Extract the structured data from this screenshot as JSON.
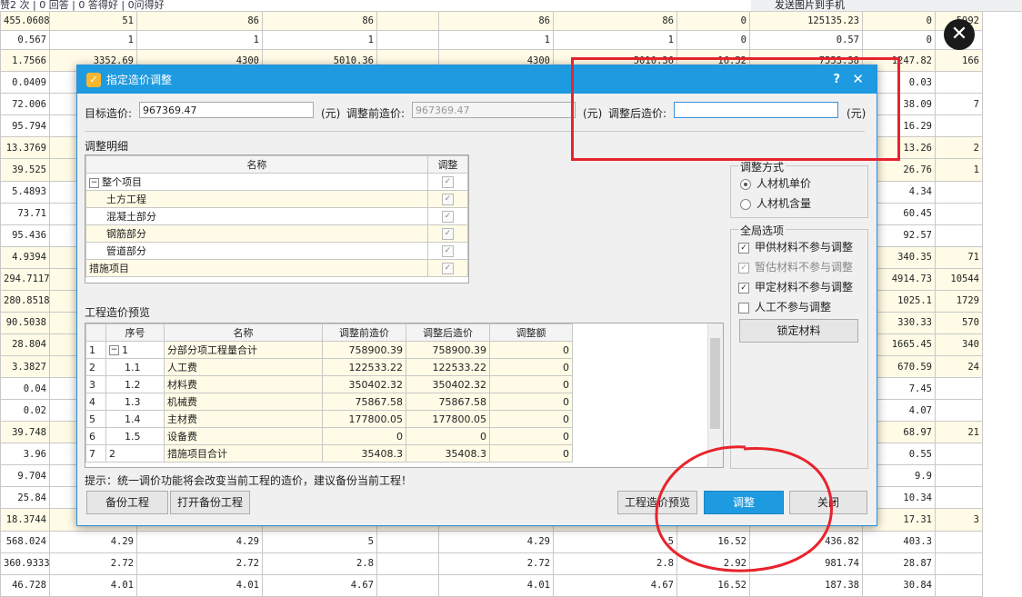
{
  "background": {
    "topbar_text": "赞2 次 | 0 回答 | 0 答得好 | 0问得好",
    "toolbar_right": [
      "发送图片到手机"
    ],
    "rows": [
      {
        "cls": "y",
        "c": [
          "455.0608",
          "51",
          "86",
          "86",
          "",
          "86",
          "86",
          "0",
          "125135.23",
          "0",
          "5992"
        ]
      },
      {
        "cls": "w",
        "c": [
          "0.567",
          "1",
          "1",
          "1",
          "",
          "1",
          "1",
          "0",
          "0.57",
          "0",
          ""
        ]
      },
      {
        "cls": "y",
        "c": [
          "1.7566",
          "3352.69",
          "4300",
          "5010.36",
          "",
          "4300",
          "5010.36",
          "16.52",
          "7553.38",
          "1247.82",
          "166"
        ]
      },
      {
        "cls": "w",
        "c": [
          "0.0409",
          "",
          "",
          "",
          "",
          "",
          "",
          "",
          "",
          "0.03",
          ""
        ]
      },
      {
        "cls": "w",
        "c": [
          "72.006",
          "",
          "",
          "",
          "",
          "",
          "",
          "",
          "",
          "38.09",
          "7"
        ]
      },
      {
        "cls": "w",
        "c": [
          "95.794",
          "",
          "",
          "",
          "",
          "",
          "",
          "",
          "",
          "16.29",
          ""
        ]
      },
      {
        "cls": "y",
        "c": [
          "13.3769",
          "",
          "",
          "",
          "",
          "",
          "",
          "",
          "",
          "13.26",
          "2"
        ]
      },
      {
        "cls": "y",
        "c": [
          "39.525",
          "",
          "",
          "",
          "",
          "",
          "",
          "",
          "",
          "26.76",
          "1"
        ]
      },
      {
        "cls": "w",
        "c": [
          "5.4893",
          "",
          "",
          "",
          "",
          "",
          "",
          "",
          "",
          "4.34",
          ""
        ]
      },
      {
        "cls": "w",
        "c": [
          "73.71",
          "",
          "",
          "",
          "",
          "",
          "",
          "",
          "",
          "60.45",
          ""
        ]
      },
      {
        "cls": "w",
        "c": [
          "95.436",
          "",
          "",
          "",
          "",
          "",
          "",
          "",
          "",
          "92.57",
          ""
        ]
      },
      {
        "cls": "y",
        "c": [
          "4.9394",
          "",
          "",
          "",
          "",
          "",
          "",
          "",
          "",
          "340.35",
          "71"
        ]
      },
      {
        "cls": "y",
        "c": [
          "294.7117",
          "",
          "",
          "",
          "",
          "",
          "",
          "",
          "",
          "4914.73",
          "10544"
        ]
      },
      {
        "cls": "y",
        "c": [
          "280.8518",
          "",
          "",
          "",
          "",
          "",
          "",
          "",
          "",
          "1025.1",
          "1729"
        ]
      },
      {
        "cls": "y",
        "c": [
          "90.5038",
          "",
          "",
          "",
          "",
          "",
          "",
          "",
          "",
          "330.33",
          "570"
        ]
      },
      {
        "cls": "y",
        "c": [
          "28.804",
          "",
          "",
          "",
          "",
          "",
          "",
          "",
          "",
          "1665.45",
          "340"
        ]
      },
      {
        "cls": "y",
        "c": [
          "3.3827",
          "",
          "",
          "",
          "",
          "",
          "",
          "",
          "",
          "670.59",
          "24"
        ]
      },
      {
        "cls": "w",
        "c": [
          "0.04",
          "",
          "",
          "",
          "",
          "",
          "",
          "",
          "",
          "7.45",
          ""
        ]
      },
      {
        "cls": "w",
        "c": [
          "0.02",
          "",
          "",
          "",
          "",
          "",
          "",
          "",
          "",
          "4.07",
          ""
        ]
      },
      {
        "cls": "y",
        "c": [
          "39.748",
          "",
          "",
          "",
          "",
          "",
          "",
          "",
          "",
          "68.97",
          "21"
        ]
      },
      {
        "cls": "w",
        "c": [
          "3.96",
          "",
          "",
          "",
          "",
          "",
          "",
          "",
          "",
          "0.55",
          ""
        ]
      },
      {
        "cls": "w",
        "c": [
          "9.704",
          "",
          "",
          "",
          "",
          "",
          "",
          "",
          "",
          "9.9",
          ""
        ]
      },
      {
        "cls": "w",
        "c": [
          "25.84",
          "",
          "",
          "",
          "",
          "",
          "",
          "",
          "",
          "10.34",
          ""
        ]
      },
      {
        "cls": "y",
        "c": [
          "18.3744",
          "",
          "",
          "",
          "",
          "",
          "",
          "",
          "",
          "17.31",
          "3"
        ]
      },
      {
        "cls": "w",
        "c": [
          "568.024",
          "4.29",
          "4.29",
          "5",
          "",
          "4.29",
          "5",
          "16.52",
          "436.82",
          "403.3",
          ""
        ]
      },
      {
        "cls": "w",
        "c": [
          "360.9333",
          "2.72",
          "2.72",
          "2.8",
          "",
          "2.72",
          "2.8",
          "2.92",
          "981.74",
          "28.87",
          ""
        ]
      },
      {
        "cls": "w",
        "c": [
          "46.728",
          "4.01",
          "4.01",
          "4.67",
          "",
          "4.01",
          "4.67",
          "16.52",
          "187.38",
          "30.84",
          ""
        ]
      }
    ]
  },
  "dialog": {
    "title": "指定造价调整",
    "help": "?",
    "close": "✕",
    "target_label": "目标造价:",
    "target_value": "967369.47",
    "unit": "(元)",
    "before_label": "调整前造价:",
    "before_value": "967369.47",
    "after_label": "调整后造价:",
    "after_value": "",
    "detail_label": "调整明细",
    "detail_table": {
      "headers": [
        "名称",
        "调整"
      ],
      "rows": [
        {
          "name": "整个项目",
          "level": 0,
          "expander": "−"
        },
        {
          "name": "土方工程",
          "level": 1
        },
        {
          "name": "混凝土部分",
          "level": 1
        },
        {
          "name": "钢筋部分",
          "level": 1
        },
        {
          "name": "管道部分",
          "level": 1
        },
        {
          "name": "措施项目",
          "level": 0
        }
      ]
    },
    "method_group": {
      "title": "调整方式",
      "options": [
        {
          "label": "人材机单价",
          "selected": true
        },
        {
          "label": "人材机含量",
          "selected": false
        }
      ]
    },
    "global_group": {
      "title": "全局选项",
      "options": [
        {
          "label": "甲供材料不参与调整",
          "checked": true
        },
        {
          "label": "暂估材料不参与调整",
          "checked": true,
          "disabled": true
        },
        {
          "label": "甲定材料不参与调整",
          "checked": true
        },
        {
          "label": "人工不参与调整",
          "checked": false
        }
      ],
      "lock_button": "锁定材料"
    },
    "preview_label": "工程造价预览",
    "preview_table": {
      "headers": [
        "序号",
        "名称",
        "调整前造价",
        "调整后造价",
        "调整额"
      ],
      "rows": [
        {
          "idx": "1",
          "code": "1",
          "name": "分部分项工程量合计",
          "before": "758900.39",
          "after": "758900.39",
          "diff": "0",
          "expander": "−",
          "level": 0
        },
        {
          "idx": "2",
          "code": "1.1",
          "name": "人工费",
          "before": "122533.22",
          "after": "122533.22",
          "diff": "0",
          "level": 1
        },
        {
          "idx": "3",
          "code": "1.2",
          "name": "材料费",
          "before": "350402.32",
          "after": "350402.32",
          "diff": "0",
          "level": 1
        },
        {
          "idx": "4",
          "code": "1.3",
          "name": "机械费",
          "before": "75867.58",
          "after": "75867.58",
          "diff": "0",
          "level": 1
        },
        {
          "idx": "5",
          "code": "1.4",
          "name": "主材费",
          "before": "177800.05",
          "after": "177800.05",
          "diff": "0",
          "level": 1
        },
        {
          "idx": "6",
          "code": "1.5",
          "name": "设备费",
          "before": "0",
          "after": "0",
          "diff": "0",
          "level": 1
        },
        {
          "idx": "7",
          "code": "2",
          "name": "措施项目合计",
          "before": "35408.3",
          "after": "35408.3",
          "diff": "0",
          "level": 0
        }
      ]
    },
    "hint": "提示：统一调价功能将会改变当前工程的造价，建议备份当前工程！",
    "buttons": {
      "backup": "备份工程",
      "open_backup": "打开备份工程",
      "preview": "工程造价预览",
      "adjust": "调整",
      "close": "关闭"
    }
  },
  "colors": {
    "accent": "#1e9ae0",
    "annotation": "#e8232c"
  }
}
